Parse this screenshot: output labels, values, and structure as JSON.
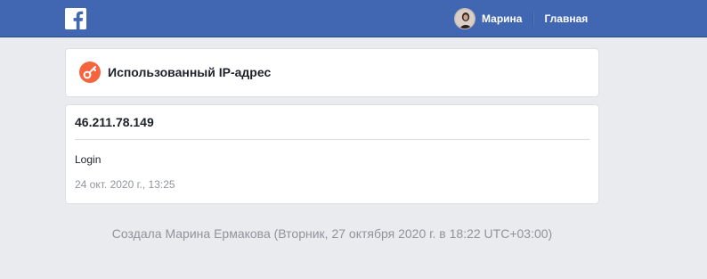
{
  "header": {
    "logo_icon": "facebook-f-logo-icon",
    "user_name": "Марина",
    "home_label": "Главная"
  },
  "section": {
    "icon": "key-icon",
    "icon_color": "#f5643c",
    "title": "Использованный IP-адрес"
  },
  "entry": {
    "ip": "46.211.78.149",
    "event": "Login",
    "timestamp": "24 окт. 2020 г., 13:25"
  },
  "footer": {
    "text": "Создала Марина Ермакова (Вторник, 27 октября 2020 г. в 18:22 UTC+03:00)"
  },
  "colors": {
    "topbar": "#4267b2",
    "background": "#e9ebee"
  }
}
